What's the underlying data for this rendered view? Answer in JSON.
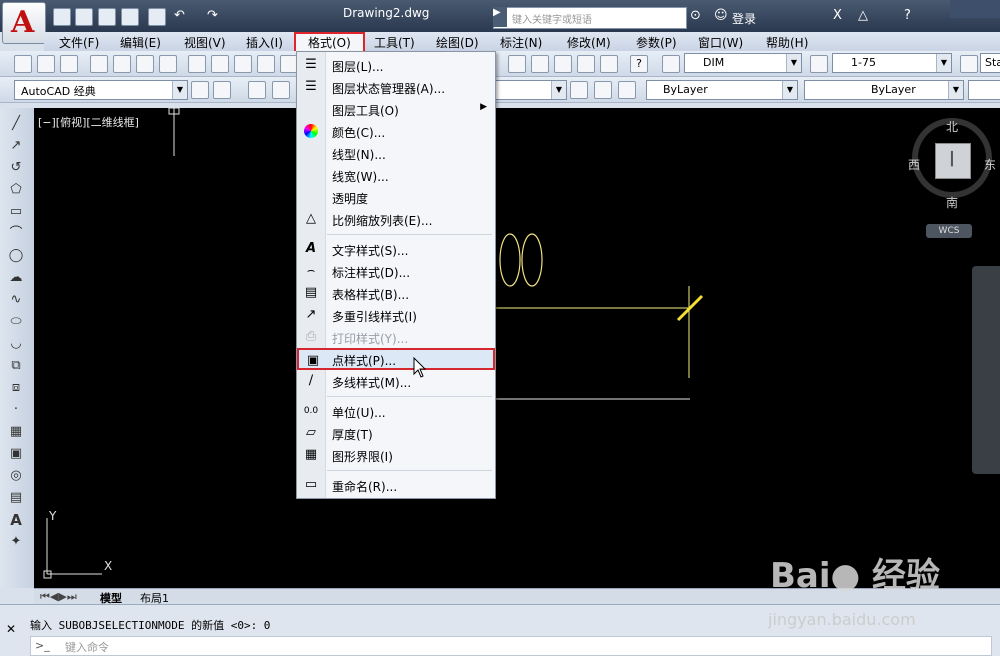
{
  "window": {
    "document_title": "Drawing2.dwg",
    "search_placeholder": "键入关键字或短语",
    "login_label": "登录"
  },
  "menubar": [
    {
      "label": "文件(F)"
    },
    {
      "label": "编辑(E)"
    },
    {
      "label": "视图(V)"
    },
    {
      "label": "插入(I)"
    },
    {
      "label": "格式(O)"
    },
    {
      "label": "工具(T)"
    },
    {
      "label": "绘图(D)"
    },
    {
      "label": "标注(N)"
    },
    {
      "label": "修改(M)"
    },
    {
      "label": "参数(P)"
    },
    {
      "label": "窗口(W)"
    },
    {
      "label": "帮助(H)"
    }
  ],
  "toolbar": {
    "workspace": "AutoCAD 经典",
    "dim_style": "DIM",
    "scale": "1-75",
    "text_style_partial": "Sta",
    "color": "ByLayer",
    "linetype": "ByLayer"
  },
  "format_menu": {
    "items": [
      {
        "label": "图层(L)...",
        "icon": "layer-icon"
      },
      {
        "label": "图层状态管理器(A)...",
        "icon": "layer-state-icon"
      },
      {
        "label": "图层工具(O)",
        "icon": ""
      },
      {
        "label": "颜色(C)...",
        "icon": "color-wheel-icon"
      },
      {
        "label": "线型(N)...",
        "icon": ""
      },
      {
        "label": "线宽(W)...",
        "icon": ""
      },
      {
        "label": "透明度",
        "icon": ""
      },
      {
        "label": "比例缩放列表(E)...",
        "icon": "scale-list-icon"
      },
      {
        "label": "文字样式(S)...",
        "icon": "text-style-icon"
      },
      {
        "label": "标注样式(D)...",
        "icon": "dim-style-icon"
      },
      {
        "label": "表格样式(B)...",
        "icon": "table-style-icon"
      },
      {
        "label": "多重引线样式(I)",
        "icon": "mleader-style-icon"
      },
      {
        "label": "打印样式(Y)...",
        "icon": "plot-style-icon"
      },
      {
        "label": "点样式(P)...",
        "icon": "point-style-icon"
      },
      {
        "label": "多线样式(M)...",
        "icon": "mline-style-icon"
      },
      {
        "label": "单位(U)...",
        "icon": "units-icon"
      },
      {
        "label": "厚度(T)",
        "icon": "thickness-icon"
      },
      {
        "label": "图形界限(I)",
        "icon": "limits-icon"
      },
      {
        "label": "重命名(R)...",
        "icon": "rename-icon"
      }
    ]
  },
  "viewport": {
    "label": "[−][俯视][二维线框]",
    "compass": {
      "north": "北",
      "south": "南",
      "east": "东",
      "west": "西",
      "wcs": "WCS"
    }
  },
  "layout_tabs": {
    "model": "模型",
    "layout1": "布局1"
  },
  "command": {
    "history": "输入 SUBOBJSELECTIONMODE 的新值 <0>: 0",
    "prompt_placeholder": "键入命令"
  },
  "watermark": {
    "brand": "Bai● 经验",
    "url": "jingyan.baidu.com"
  }
}
